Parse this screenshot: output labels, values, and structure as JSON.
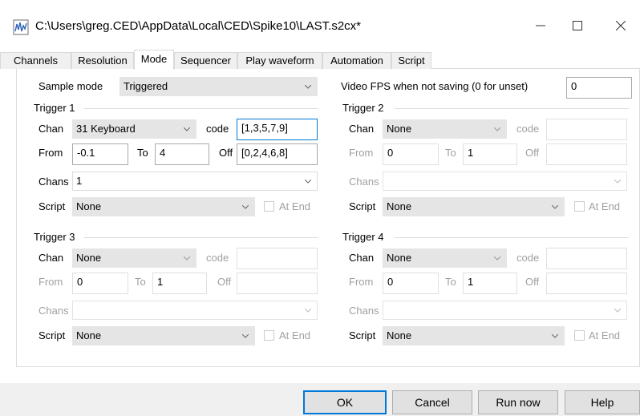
{
  "window": {
    "title": "C:\\Users\\greg.CED\\AppData\\Local\\CED\\Spike10\\LAST.s2cx*"
  },
  "tabs": [
    "Channels",
    "Resolution",
    "Mode",
    "Sequencer",
    "Play waveform",
    "Automation",
    "Script"
  ],
  "mode": {
    "sample_mode_label": "Sample mode",
    "sample_mode_value": "Triggered",
    "video_fps_label": "Video FPS when not saving (0 for unset)",
    "video_fps_value": "0"
  },
  "labels": {
    "chan": "Chan",
    "code": "code",
    "from": "From",
    "to": "To",
    "off": "Off",
    "chans": "Chans",
    "script": "Script",
    "at_end": "At End"
  },
  "triggers": [
    {
      "title": "Trigger 1",
      "chan": "31 Keyboard",
      "code": "[1,3,5,7,9]",
      "from": "-0.1",
      "to": "4",
      "off": "[0,2,4,6,8]",
      "chans": "1",
      "script": "None"
    },
    {
      "title": "Trigger 2",
      "chan": "None",
      "code": "",
      "from": "0",
      "to": "1",
      "off": "",
      "chans": "",
      "script": "None"
    },
    {
      "title": "Trigger 3",
      "chan": "None",
      "code": "",
      "from": "0",
      "to": "1",
      "off": "",
      "chans": "",
      "script": "None"
    },
    {
      "title": "Trigger 4",
      "chan": "None",
      "code": "",
      "from": "0",
      "to": "1",
      "off": "",
      "chans": "",
      "script": "None"
    }
  ],
  "buttons": {
    "ok": "OK",
    "cancel": "Cancel",
    "run_now": "Run now",
    "help": "Help"
  },
  "colors": {
    "accent": "#0078d7",
    "disabled_text": "#a0a0a0",
    "combo_bg": "#e5e5e5"
  }
}
